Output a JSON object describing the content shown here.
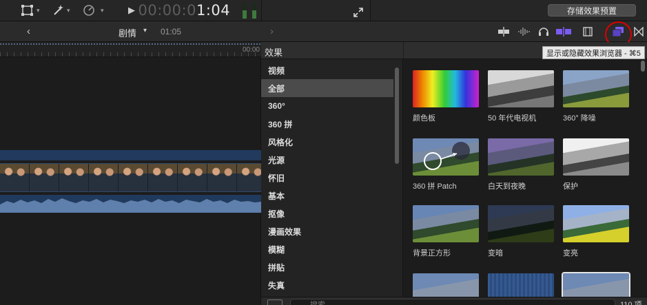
{
  "toolbar": {
    "icons": [
      "transform-icon",
      "magic-wand-icon",
      "retime-gauge-icon"
    ],
    "timecode_dim": "00:00:0",
    "timecode_lit": "1:04",
    "save_preset_label": "存储效果预置",
    "fullscreen_icon": "expand-diagonal-icon"
  },
  "navbar": {
    "project_name": "剧情",
    "project_duration": "01:05",
    "tools": [
      "clip-appearance-icon",
      "audio-waveform-icon",
      "headphones-icon",
      "skimming-icon",
      "film-strip-icon",
      "effects-browser-icon",
      "transitions-browser-icon"
    ]
  },
  "timeline": {
    "ruler_label": "00:00"
  },
  "effects": {
    "header": "效果",
    "categories": [
      {
        "label": "视频",
        "selected": false
      },
      {
        "label": "全部",
        "selected": true
      },
      {
        "label": "360°",
        "selected": false
      },
      {
        "label": "360 拼",
        "selected": false
      },
      {
        "label": "风格化",
        "selected": false
      },
      {
        "label": "光源",
        "selected": false
      },
      {
        "label": "怀旧",
        "selected": false
      },
      {
        "label": "基本",
        "selected": false
      },
      {
        "label": "抠像",
        "selected": false
      },
      {
        "label": "漫画效果",
        "selected": false
      },
      {
        "label": "模糊",
        "selected": false
      },
      {
        "label": "拼贴",
        "selected": false
      },
      {
        "label": "失真",
        "selected": false
      }
    ],
    "thumbnails": [
      {
        "label": "颜色板",
        "style": "rainbow"
      },
      {
        "label": "50 年代电视机",
        "style": "bw"
      },
      {
        "label": "360° 降噪",
        "style": "noise"
      },
      {
        "label": "360 拼 Patch",
        "style": "patch"
      },
      {
        "label": "白天到夜晚",
        "style": "dusk"
      },
      {
        "label": "保护",
        "style": "bw-light"
      },
      {
        "label": "背景正方形",
        "style": "square"
      },
      {
        "label": "变暗",
        "style": "dark"
      },
      {
        "label": "变亮",
        "style": "bright"
      },
      {
        "label": "",
        "style": "plain"
      },
      {
        "label": "",
        "style": "blue-tex"
      },
      {
        "label": "",
        "style": "frame-sel"
      }
    ],
    "tooltip": "显示或隐藏效果浏览器 - ⌘5",
    "search_placeholder": "搜索",
    "count": "110 项"
  },
  "colors": {
    "accent_purple": "#7b5cf0",
    "highlight_ring": "#e00000",
    "timeline_blue": "#213a5e"
  }
}
